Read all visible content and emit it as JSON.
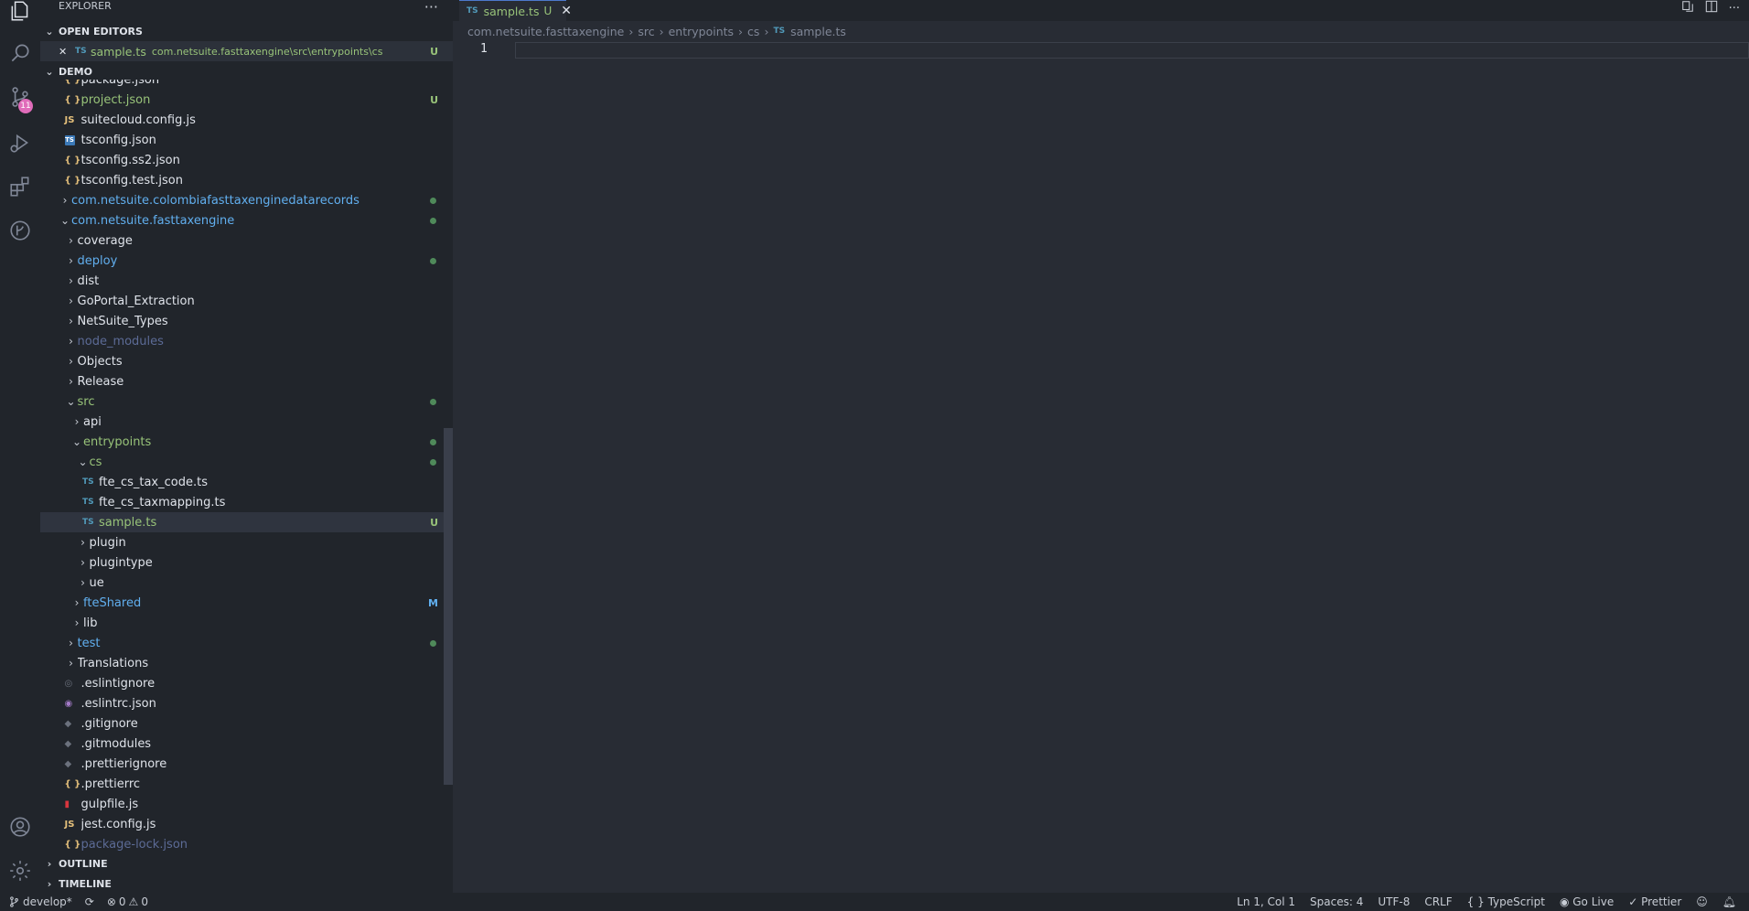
{
  "sidebar": {
    "title": "EXPLORER",
    "more": "···",
    "open_editors": {
      "header": "OPEN EDITORS",
      "items": [
        {
          "close": "✕",
          "icon": "TS",
          "name": "sample.ts",
          "path": "com.netsuite.fasttaxengine\\src\\entrypoints\\cs",
          "status": "U"
        }
      ]
    },
    "demo_header": "DEMO",
    "tree": [
      {
        "name": "package.json",
        "icon": "{ }",
        "iconClass": "fi-json",
        "color": "c-default",
        "indent": 0,
        "kind": "file"
      },
      {
        "name": "project.json",
        "icon": "{ }",
        "iconClass": "fi-json",
        "color": "c-green",
        "indent": 0,
        "kind": "file",
        "deco": "U"
      },
      {
        "name": "suitecloud.config.js",
        "icon": "JS",
        "iconClass": "fi-js",
        "color": "c-default",
        "indent": 0,
        "kind": "file"
      },
      {
        "name": "tsconfig.json",
        "icon": "TS",
        "iconClass": "fi-tsc",
        "color": "c-default",
        "indent": 0,
        "kind": "file"
      },
      {
        "name": "tsconfig.ss2.json",
        "icon": "{ }",
        "iconClass": "fi-json",
        "color": "c-default",
        "indent": 0,
        "kind": "file"
      },
      {
        "name": "tsconfig.test.json",
        "icon": "{ }",
        "iconClass": "fi-json",
        "color": "c-default",
        "indent": 0,
        "kind": "file"
      },
      {
        "name": "com.netsuite.colombiafasttaxenginedatarecords",
        "chevron": "›",
        "color": "c-blue",
        "indent": -1,
        "kind": "folder",
        "dot": true
      },
      {
        "name": "com.netsuite.fasttaxengine",
        "chevron": "⌄",
        "color": "c-blue",
        "indent": -1,
        "kind": "folder",
        "dot": true
      },
      {
        "name": "coverage",
        "chevron": "›",
        "color": "c-default",
        "indent": 0,
        "kind": "folder"
      },
      {
        "name": "deploy",
        "chevron": "›",
        "color": "c-blue",
        "indent": 0,
        "kind": "folder",
        "dot": true
      },
      {
        "name": "dist",
        "chevron": "›",
        "color": "c-default",
        "indent": 0,
        "kind": "folder"
      },
      {
        "name": "GoPortal_Extraction",
        "chevron": "›",
        "color": "c-default",
        "indent": 0,
        "kind": "folder"
      },
      {
        "name": "NetSuite_Types",
        "chevron": "›",
        "color": "c-default",
        "indent": 0,
        "kind": "folder"
      },
      {
        "name": "node_modules",
        "chevron": "›",
        "color": "c-dim",
        "indent": 0,
        "kind": "folder"
      },
      {
        "name": "Objects",
        "chevron": "›",
        "color": "c-default",
        "indent": 0,
        "kind": "folder"
      },
      {
        "name": "Release",
        "chevron": "›",
        "color": "c-default",
        "indent": 0,
        "kind": "folder"
      },
      {
        "name": "src",
        "chevron": "⌄",
        "color": "c-green",
        "indent": 0,
        "kind": "folder",
        "dot": true
      },
      {
        "name": "api",
        "chevron": "›",
        "color": "c-default",
        "indent": 1,
        "kind": "folder"
      },
      {
        "name": "entrypoints",
        "chevron": "⌄",
        "color": "c-green",
        "indent": 1,
        "kind": "folder",
        "dot": true
      },
      {
        "name": "cs",
        "chevron": "⌄",
        "color": "c-green",
        "indent": 2,
        "kind": "folder",
        "dot": true
      },
      {
        "name": "fte_cs_tax_code.ts",
        "icon": "TS",
        "iconClass": "fi-ts",
        "color": "c-default",
        "indent": 3,
        "kind": "file"
      },
      {
        "name": "fte_cs_taxmapping.ts",
        "icon": "TS",
        "iconClass": "fi-ts",
        "color": "c-default",
        "indent": 3,
        "kind": "file"
      },
      {
        "name": "sample.ts",
        "icon": "TS",
        "iconClass": "fi-ts",
        "color": "c-green",
        "indent": 3,
        "kind": "file",
        "deco": "U",
        "active": true
      },
      {
        "name": "plugin",
        "chevron": "›",
        "color": "c-default",
        "indent": 2,
        "kind": "folder"
      },
      {
        "name": "plugintype",
        "chevron": "›",
        "color": "c-default",
        "indent": 2,
        "kind": "folder"
      },
      {
        "name": "ue",
        "chevron": "›",
        "color": "c-default",
        "indent": 2,
        "kind": "folder"
      },
      {
        "name": "fteShared",
        "chevron": "›",
        "color": "c-blue",
        "indent": 1,
        "kind": "folder",
        "deco": "M"
      },
      {
        "name": "lib",
        "chevron": "›",
        "color": "c-default",
        "indent": 1,
        "kind": "folder"
      },
      {
        "name": "test",
        "chevron": "›",
        "color": "c-blue",
        "indent": 0,
        "kind": "folder",
        "dot": true
      },
      {
        "name": "Translations",
        "chevron": "›",
        "color": "c-default",
        "indent": 0,
        "kind": "folder"
      },
      {
        "name": ".eslintignore",
        "icon": "◎",
        "iconClass": "fi-cfg",
        "color": "c-default",
        "indent": 0,
        "kind": "file"
      },
      {
        "name": ".eslintrc.json",
        "icon": "◉",
        "iconClass": "fi-eslint",
        "color": "c-default",
        "indent": 0,
        "kind": "file"
      },
      {
        "name": ".gitignore",
        "icon": "◆",
        "iconClass": "fi-cfg",
        "color": "c-default",
        "indent": 0,
        "kind": "file"
      },
      {
        "name": ".gitmodules",
        "icon": "◆",
        "iconClass": "fi-cfg",
        "color": "c-default",
        "indent": 0,
        "kind": "file"
      },
      {
        "name": ".prettierignore",
        "icon": "◆",
        "iconClass": "fi-cfg",
        "color": "c-default",
        "indent": 0,
        "kind": "file"
      },
      {
        "name": ".prettierrc",
        "icon": "{ }",
        "iconClass": "fi-json",
        "color": "c-default",
        "indent": 0,
        "kind": "file"
      },
      {
        "name": "gulpfile.js",
        "icon": "▮",
        "iconClass": "fi-gulp",
        "color": "c-default",
        "indent": 0,
        "kind": "file"
      },
      {
        "name": "jest.config.js",
        "icon": "JS",
        "iconClass": "fi-js",
        "color": "c-default",
        "indent": 0,
        "kind": "file"
      },
      {
        "name": "package-lock.json",
        "icon": "{ }",
        "iconClass": "fi-json",
        "color": "c-dim",
        "indent": 0,
        "kind": "file"
      }
    ],
    "outline_header": "OUTLINE",
    "timeline_header": "TIMELINE"
  },
  "activity": {
    "scm_badge": "11"
  },
  "editor": {
    "tab": {
      "icon": "TS",
      "label": "sample.ts",
      "status": "U",
      "close": "✕"
    },
    "actions_more": "···",
    "breadcrumb": [
      "com.netsuite.fasttaxengine",
      "src",
      "entrypoints",
      "cs"
    ],
    "breadcrumb_file_icon": "TS",
    "breadcrumb_file": "sample.ts",
    "line_number": "1"
  },
  "statusbar": {
    "branch": "develop*",
    "errors": "0",
    "warnings": "0",
    "position": "Ln 1, Col 1",
    "spaces": "Spaces: 4",
    "encoding": "UTF-8",
    "eol": "CRLF",
    "language": "TypeScript",
    "golive": "Go Live",
    "prettier": "Prettier"
  },
  "colors": {
    "accent_green": "#98c379",
    "accent_blue": "#61afef",
    "background": "#282c34",
    "sidebar": "#21252b",
    "badge": "#e06cba"
  }
}
